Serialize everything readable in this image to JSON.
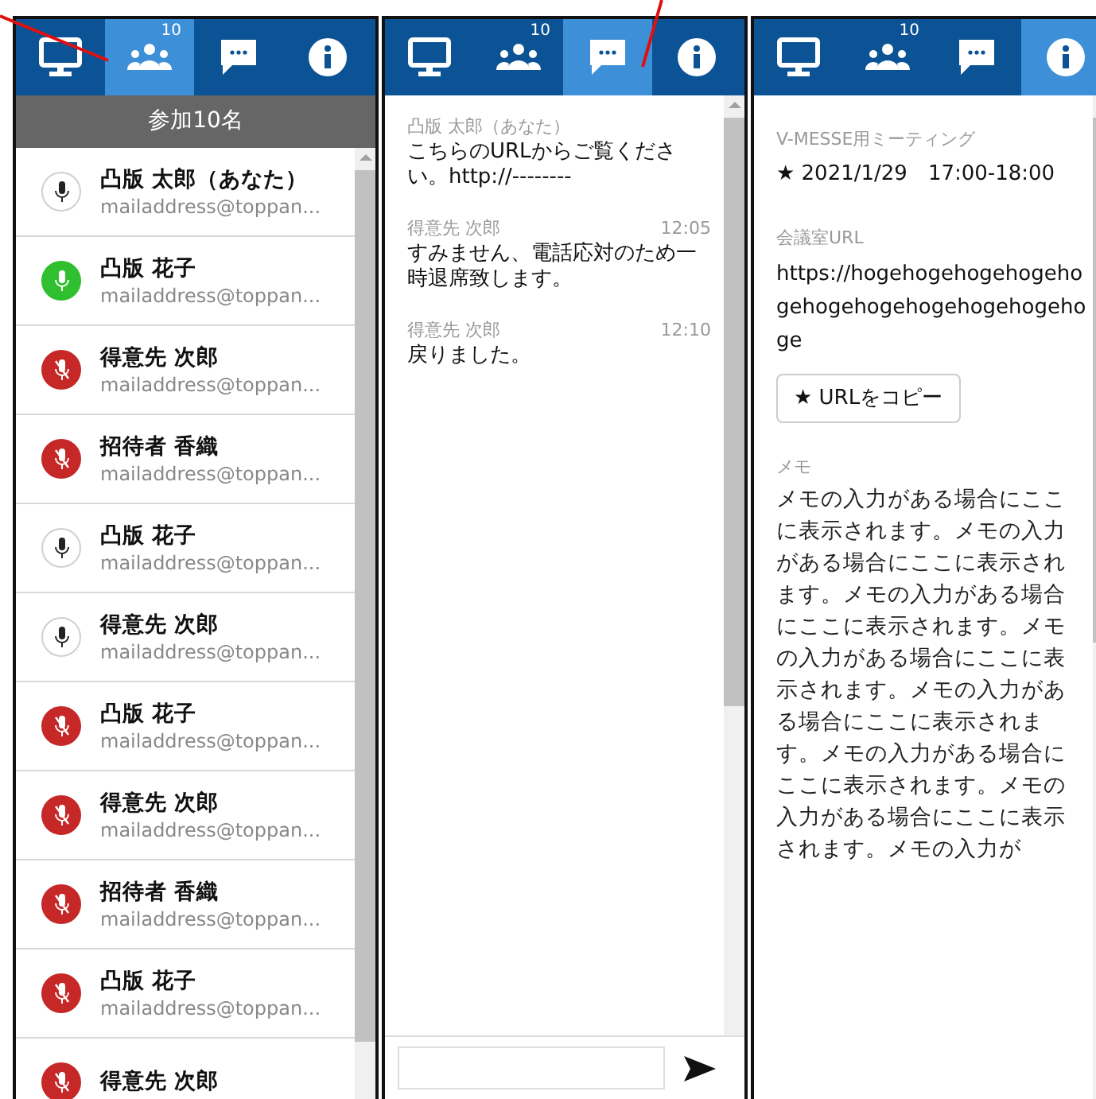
{
  "panels": [
    {
      "kind": "participants",
      "tabs": [
        {
          "kind": "monitor",
          "selected": false
        },
        {
          "kind": "people",
          "badge": "10",
          "selected": true
        },
        {
          "kind": "chat",
          "selected": false
        },
        {
          "kind": "info",
          "selected": false
        }
      ],
      "header": "参加10名",
      "participants": [
        {
          "name": "凸版 太郎（あなた）",
          "email": "mailaddress@toppan...",
          "kind": "idle"
        },
        {
          "name": "凸版 花子",
          "email": "mailaddress@toppan...",
          "kind": "speaking"
        },
        {
          "name": "得意先 次郎",
          "email": "mailaddress@toppan...",
          "kind": "muted"
        },
        {
          "name": "招待者 香織",
          "email": "mailaddress@toppan...",
          "kind": "muted"
        },
        {
          "name": "凸版 花子",
          "email": "mailaddress@toppan...",
          "kind": "idle"
        },
        {
          "name": "得意先 次郎",
          "email": "mailaddress@toppan...",
          "kind": "idle"
        },
        {
          "name": "凸版 花子",
          "email": "mailaddress@toppan...",
          "kind": "muted"
        },
        {
          "name": "得意先 次郎",
          "email": "mailaddress@toppan...",
          "kind": "muted"
        },
        {
          "name": "招待者 香織",
          "email": "mailaddress@toppan...",
          "kind": "muted"
        },
        {
          "name": "凸版 花子",
          "email": "mailaddress@toppan...",
          "kind": "muted"
        },
        {
          "name": "得意先 次郎",
          "kind": "muted"
        }
      ]
    },
    {
      "kind": "chat",
      "tabs": [
        {
          "kind": "monitor",
          "selected": false
        },
        {
          "kind": "people",
          "badge": "10",
          "selected": false
        },
        {
          "kind": "chat",
          "selected": true
        },
        {
          "kind": "info",
          "selected": false
        }
      ],
      "messages": [
        {
          "sender": "凸版 太郎（あなた）",
          "text": "こちらのURLからご覧ください。http://--------"
        },
        {
          "sender": "得意先 次郎",
          "time": "12:05",
          "text": "すみません、電話応対のため一時退席致します。"
        },
        {
          "sender": "得意先 次郎",
          "time": "12:10",
          "text": "戻りました。"
        }
      ]
    },
    {
      "kind": "info",
      "tabs": [
        {
          "kind": "monitor",
          "selected": false
        },
        {
          "kind": "people",
          "badge": "10",
          "selected": false
        },
        {
          "kind": "chat",
          "selected": false
        },
        {
          "kind": "info",
          "selected": true
        }
      ],
      "meeting_label": "V-MESSE用ミーティング",
      "meeting_time": "★ 2021/1/29　17:00-18:00",
      "url_label": "会議室URL",
      "url": "https://hogehogehogehogehogehogehogehogehogehogehoge",
      "copy_button": "★ URLをコピー",
      "memo_label": "メモ",
      "memo": "メモの入力がある場合にここに表示されます。メモの入力がある場合にここに表示されます。メモの入力がある場合にここに表示されます。メモの入力がある場合にここに表示されます。メモの入力がある場合にここに表示されます。メモの入力がある場合にここに表示されます。メモの入力がある場合にここに表示されます。メモの入力が"
    }
  ]
}
